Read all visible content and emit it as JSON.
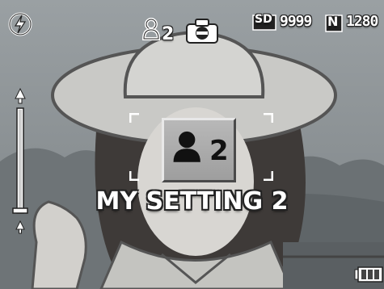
{
  "icons": {
    "flash": "flash-auto-icon",
    "mode": "my-setting-2-icon",
    "camera": "camera-icon",
    "card": "sd-card-icon",
    "quality": "quality-normal-icon",
    "battery": "battery-icon"
  },
  "status_bar": {
    "mode_number": "2",
    "card_label": "SD",
    "shots_remaining": "9999",
    "quality_label": "N",
    "resolution": "1280"
  },
  "zoom": {
    "level": 0.0
  },
  "setting_card": {
    "number": "2"
  },
  "setting_label": "MY SETTING 2",
  "colors": {
    "osd_text": "#ffffff",
    "osd_outline": "#222222",
    "card_face": "#aaaaaa"
  }
}
